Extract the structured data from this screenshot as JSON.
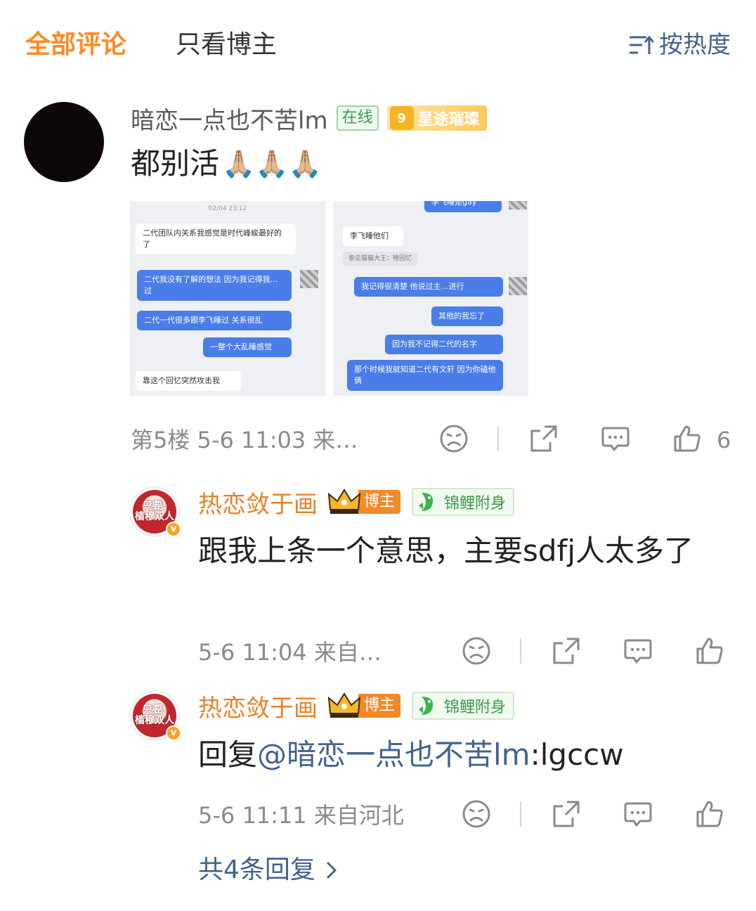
{
  "tabs": {
    "all": "全部评论",
    "owner_only": "只看博主",
    "sort": "按热度"
  },
  "comment": {
    "username": "暗恋一点也不苦lm",
    "online": "在线",
    "level": "9",
    "level_title": "星途璀璨",
    "text": "都别活",
    "emoji": "🙏🏼🙏🏼🙏🏼",
    "meta": "第5楼  5-6 11:03  来…",
    "like_count": "6",
    "images": {
      "left": {
        "timestamp": "02/04 23:12",
        "msg1": "二代团队内关系我感觉是时代峰峻最好的了",
        "msg2": "二代我没有了解的想法 因为我记得我…过",
        "msg3": "二代一代很多跟李飞睡过 关系很乱",
        "msg4": "一整个大乱睡感觉",
        "msg5": "靠这个回忆突然攻击我"
      },
      "right": {
        "msg0": "李飞睡是gay",
        "msg1": "李飞睡他们",
        "sys": "参见猫猫大王：啥回忆",
        "msg2": "我记得很清楚 他说过主…进行",
        "msg3": "其他的我忘了",
        "msg4": "因为我不记得二代的名字",
        "msg5": "那个时候我就知道二代有文轩 因为你磕他俩"
      }
    }
  },
  "replies": [
    {
      "username": "热恋敛于画",
      "owner_badge": "博主",
      "koi_badge": "锦鲤附身",
      "avatar_text": "只要!樯穆双人",
      "text": "跟我上条一个意思，主要sdfj人太多了",
      "meta": "5-6 11:04  来自…"
    },
    {
      "username": "热恋敛于画",
      "owner_badge": "博主",
      "koi_badge": "锦鲤附身",
      "avatar_text": "只要!樯穆双人",
      "text_prefix": "回复",
      "mention": "@暗恋一点也不苦lm",
      "text_suffix": ":lgccw",
      "meta": "5-6 11:11  来自河北"
    }
  ],
  "more_replies": "共4条回复",
  "colors": {
    "accent_orange": "#ff8a22",
    "link_blue": "#43628e",
    "meta_gray": "#8a8a8a"
  },
  "icons": [
    "sort-icon",
    "dislike-face-icon",
    "share-icon",
    "comment-icon",
    "like-thumb-icon",
    "chevron-right-icon",
    "crown-icon",
    "koi-fish-icon"
  ]
}
